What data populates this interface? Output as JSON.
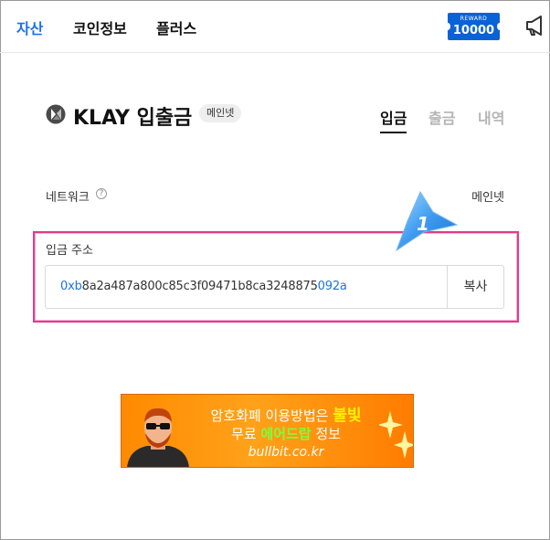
{
  "nav": {
    "items": [
      "자산",
      "코인정보",
      "플러스"
    ],
    "active_index": 0,
    "reward_label": "REWARD",
    "reward_value": "10000",
    "megaphone_icon": "megaphone-icon"
  },
  "header": {
    "coin_icon": "klay-logo-icon",
    "title": "KLAY 입출금",
    "network_badge": "메인넷",
    "tabs": [
      "입금",
      "출금",
      "내역"
    ],
    "active_tab": 0
  },
  "network": {
    "label": "네트워크",
    "help_icon": "?",
    "value": "메인넷"
  },
  "deposit": {
    "label": "입금 주소",
    "address_prefix": "0xb",
    "address_middle": "8a2a487a800c85c3f09471b8ca3248875",
    "address_suffix": "092a",
    "copy_label": "복사"
  },
  "callout": {
    "number": "1"
  },
  "banner": {
    "line1_a": "암호화폐 이용방법은 ",
    "line1_b": "불빛",
    "line2_a": "무료 ",
    "line2_b": "에어드랍",
    "line2_c": " 정보",
    "line3": "bullbit.co.kr"
  },
  "colors": {
    "accent": "#1a73e8",
    "reward_bg": "#0a63d6",
    "highlight_border": "#e23b8a",
    "banner_orange": "#ff8a00"
  }
}
